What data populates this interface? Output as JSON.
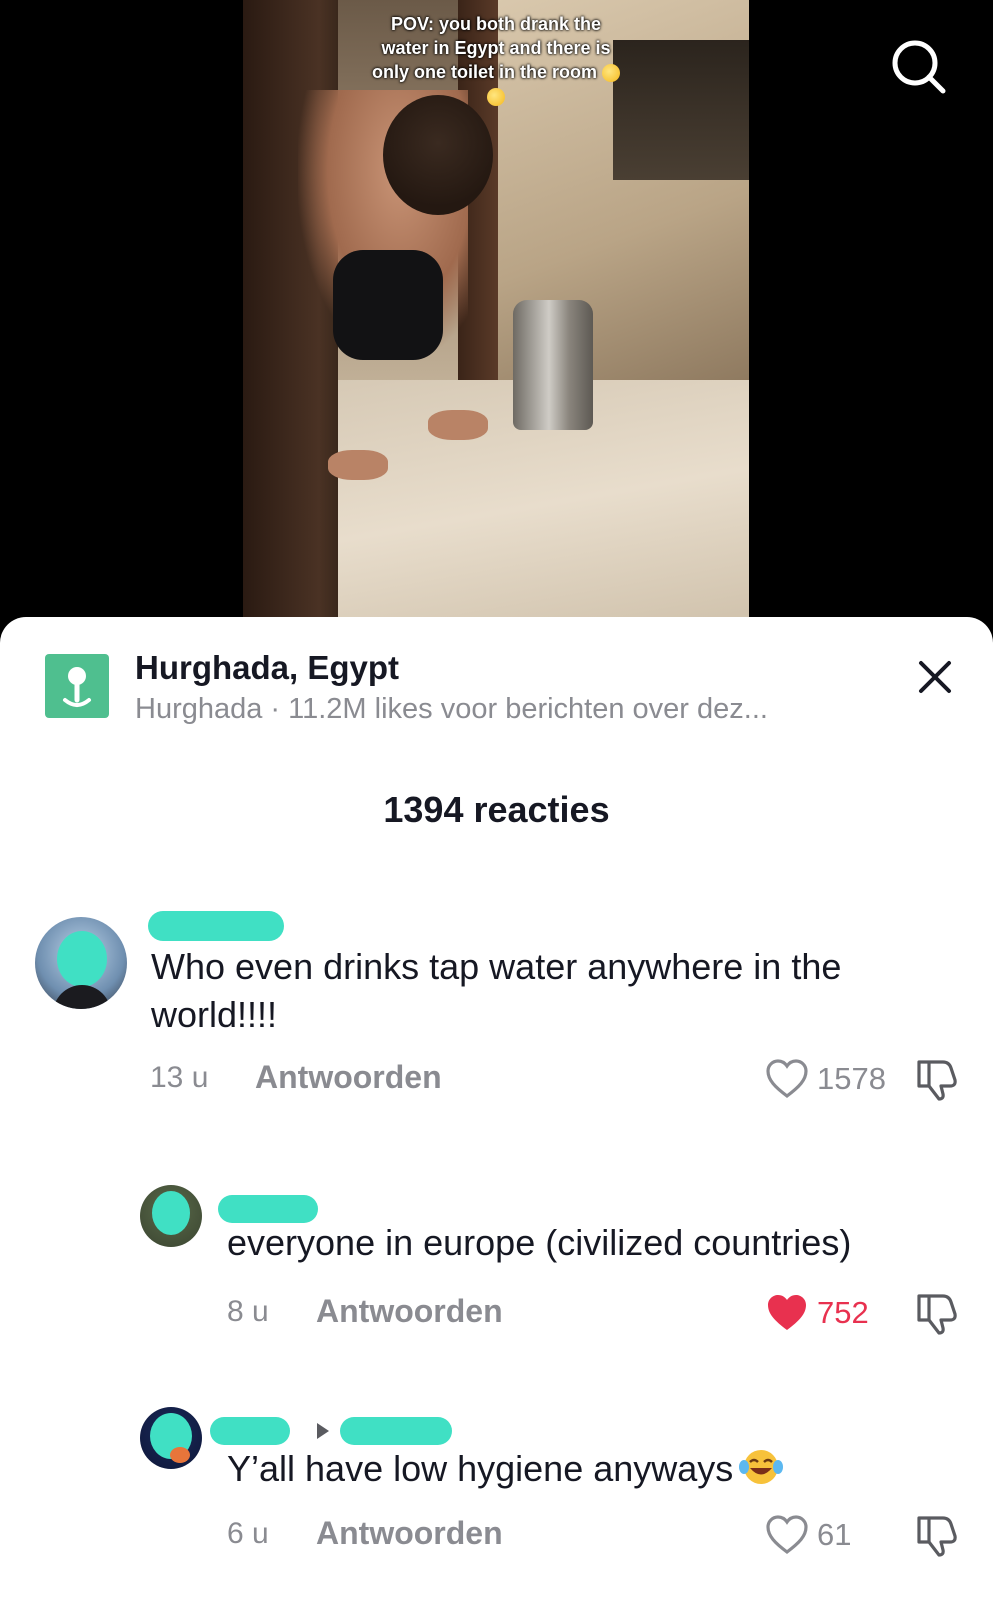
{
  "video": {
    "caption_lines": [
      "POV: you both drank the",
      "water in Egypt and there is",
      "only one toilet in the room"
    ]
  },
  "search": {
    "icon": "search-icon"
  },
  "location": {
    "title": "Hurghada, Egypt",
    "subtitle": "Hurghada · 11.2M likes voor berichten over dez...",
    "icon": "location-pin-icon"
  },
  "comments_header": {
    "count_label": "1394 reacties"
  },
  "comments": [
    {
      "text": "Who even drinks tap water anywhere in the world!!!!",
      "time": "13 u",
      "reply_label": "Antwoorden",
      "likes": "1578",
      "liked": false
    },
    {
      "text": "everyone in europe (civilized countries)",
      "time": "8 u",
      "reply_label": "Antwoorden",
      "likes": "752",
      "liked": true
    },
    {
      "text": "Y’all have low hygiene anyways",
      "time": "6 u",
      "reply_label": "Antwoorden",
      "likes": "61",
      "liked": false
    }
  ],
  "colors": {
    "accent_like": "#e8314f",
    "redaction": "#40e0c4",
    "location_icon": "#4fbf8f"
  }
}
